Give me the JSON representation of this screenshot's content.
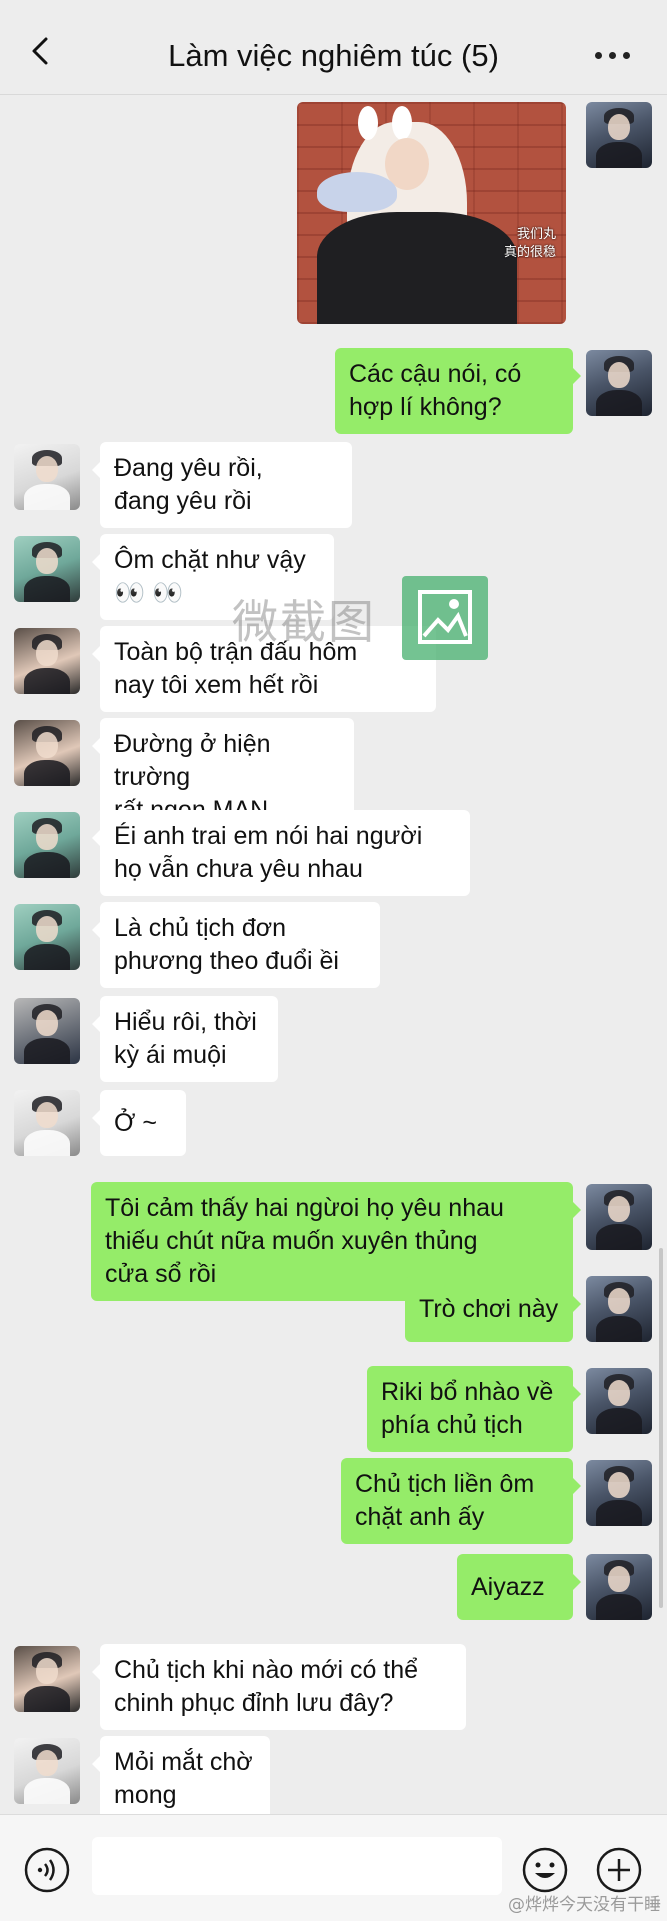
{
  "header": {
    "title": "Làm việc nghiêm túc (5)"
  },
  "photo": {
    "caption_line1": "我们丸",
    "caption_line2": "真的很稳"
  },
  "messages": [
    {
      "from": "me",
      "text": "Các cậu nói, có\nhợp lí không?"
    },
    {
      "from": "other",
      "text": "Đang yêu rồi,\nđang yêu rồi"
    },
    {
      "from": "other",
      "text": "Ôm chặt như vậy\n👀 👀"
    },
    {
      "from": "other",
      "text": "Toàn bộ trận đấu hôm\nnay tôi xem hết rồi"
    },
    {
      "from": "other",
      "text": "Đường ở hiện trường\nrất ngon MAN"
    },
    {
      "from": "other",
      "text": "Éi anh trai em nói hai người\nhọ vẫn chưa yêu nhau"
    },
    {
      "from": "other",
      "text": "Là chủ tịch đơn\nphương theo đuổi ềi"
    },
    {
      "from": "other",
      "text": "Hiểu rôi, thời\nkỳ ái muội"
    },
    {
      "from": "other",
      "text": "Ở ~"
    },
    {
      "from": "me",
      "text": "Tôi cảm thấy hai ngừoi họ yêu nhau\nthiếu chút nữa muốn xuyên thủng\ncửa sổ rồi"
    },
    {
      "from": "me",
      "text": "Trò chơi này"
    },
    {
      "from": "me",
      "text": "Riki bổ nhào về\nphía chủ tịch"
    },
    {
      "from": "me",
      "text": "Chủ tịch liền ôm\nchặt anh ấy"
    },
    {
      "from": "me",
      "text": "Aiyazz"
    },
    {
      "from": "other",
      "text": "Chủ tịch khi nào mới có thể\nchinh phục đỉnh lưu đây?"
    },
    {
      "from": "other",
      "text": "Mỏi mắt chờ\nmong"
    }
  ],
  "watermark": {
    "text": "微截图"
  },
  "input_bar": {
    "value": ""
  },
  "credit": "@烨烨今天没有干睡",
  "colors": {
    "background": "#ededed",
    "outgoing_bubble": "#95ec69",
    "incoming_bubble": "#ffffff"
  },
  "icons": [
    "back-icon",
    "more-icon",
    "voice-icon",
    "emoji-icon",
    "plus-icon"
  ]
}
